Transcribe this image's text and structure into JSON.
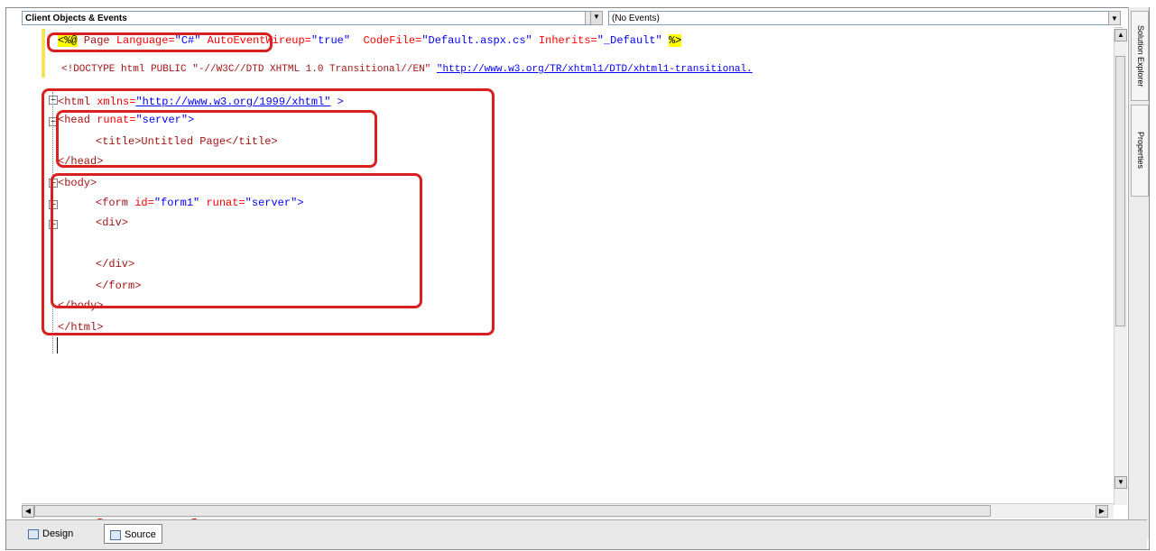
{
  "toolbar": {
    "objects_combo": "Client Objects & Events",
    "events_combo": "(No Events)"
  },
  "editor": {
    "lines": {
      "l1_open": "<%@",
      "l1_page": " Page ",
      "l1_lang_attr": "Language=",
      "l1_lang_val": "\"C#\"",
      "l1_auto_attr": " AutoEventWireup=",
      "l1_auto_val": "\"true\"",
      "l1_code_attr": "  CodeFile=",
      "l1_code_val": "\"Default.aspx.cs\"",
      "l1_inh_attr": " Inherits=",
      "l1_inh_val": "\"_Default\"",
      "l1_close": "%>",
      "l2_doctype": "<!DOCTYPE html PUBLIC \"-//W3C//DTD XHTML 1.0 Transitional//EN\" ",
      "l2_url": "\"http://www.w3.org/TR/xhtml1/DTD/xhtml1-transitional.",
      "l3_tag": "<html",
      "l3_attr": " xmlns=",
      "l3_val": "\"http://www.w3.org/1999/xhtml\"",
      "l3_end": " >",
      "l4_tag": "<head",
      "l4_attr": " runat=",
      "l4_val": "\"server\"",
      "l4_end": ">",
      "l5": "<title>Untitled Page</title>",
      "l6": "</head>",
      "l7": "<body>",
      "l8_tag": "<form",
      "l8_id_attr": " id=",
      "l8_id_val": "\"form1\"",
      "l8_run_attr": " runat=",
      "l8_run_val": "\"server\"",
      "l8_end": ">",
      "l9": "<div>",
      "l10": "</div>",
      "l11": "</form>",
      "l12": "</body>",
      "l13": "</html>"
    }
  },
  "sidebar": {
    "solution_explorer": "Solution Explorer",
    "properties": "Properties"
  },
  "bottom_tabs": {
    "design": "Design",
    "source": "Source"
  },
  "colors": {
    "highlight": "#d92020",
    "directive_bg": "#ffff00"
  }
}
